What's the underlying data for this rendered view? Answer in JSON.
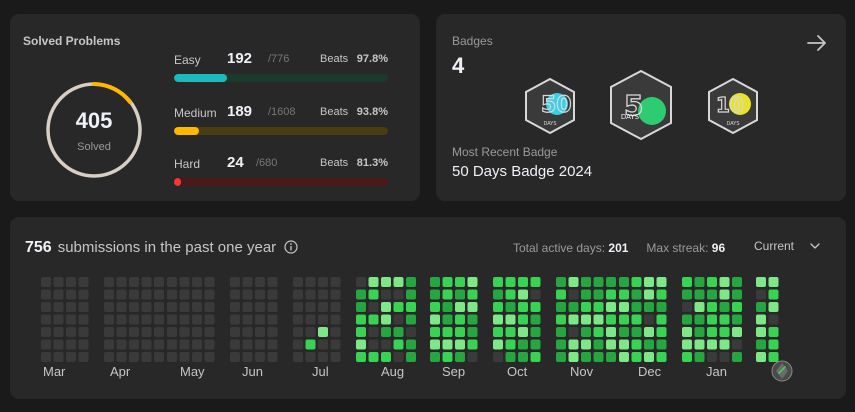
{
  "solved": {
    "title": "Solved Problems",
    "total": "405",
    "label": "Solved",
    "difficulties": [
      {
        "name": "Easy",
        "count": "192",
        "total": "/776",
        "beats_label": "Beats",
        "beats": "97.8%",
        "progress": 0.247,
        "color": "#1cbaba",
        "track": "#1c3a2c"
      },
      {
        "name": "Medium",
        "count": "189",
        "total": "/1608",
        "beats_label": "Beats",
        "beats": "93.8%",
        "progress": 0.118,
        "color": "#ffb700",
        "track": "#4a3d12"
      },
      {
        "name": "Hard",
        "count": "24",
        "total": "/680",
        "beats_label": "Beats",
        "beats": "81.3%",
        "progress": 0.035,
        "color": "#f63737",
        "track": "#4a1a1a"
      }
    ]
  },
  "badges": {
    "title": "Badges",
    "count": "4",
    "recent_label": "Most Recent Badge",
    "recent_name": "50 Days Badge 2024",
    "items": [
      {
        "icon": "50-days-badge-icon",
        "text": "DAYS",
        "accent": "#3ad0e8"
      },
      {
        "icon": "50-days-badge-2024-icon",
        "text": "DAYS",
        "accent": "#2ecc71"
      },
      {
        "icon": "100-days-badge-icon",
        "text": "DAYS",
        "accent": "#e8e22a"
      }
    ]
  },
  "submissions": {
    "count": "756",
    "text": "submissions in the past one year",
    "active_label": "Total active days:",
    "active_value": "201",
    "streak_label": "Max streak:",
    "streak_value": "96",
    "period": "Current",
    "months": [
      "Mar",
      "Apr",
      "May",
      "Jun",
      "Jul",
      "Aug",
      "Sep",
      "Oct",
      "Nov",
      "Dec",
      "Jan"
    ]
  },
  "colors": {
    "empty": "#3a3a3a",
    "level1": "#0e4429",
    "level2": "#26a641",
    "level3": "#39d353",
    "level4": "#7ee787"
  }
}
